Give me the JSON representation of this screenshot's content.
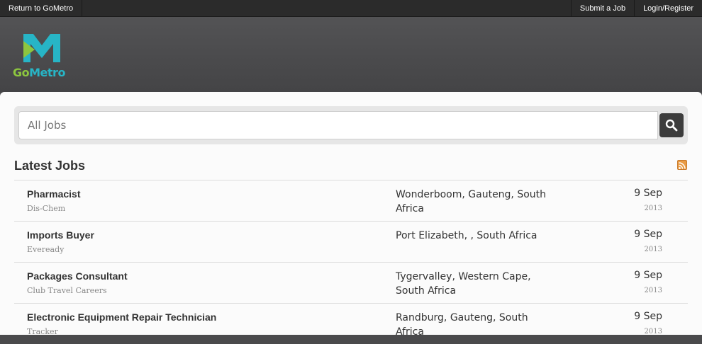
{
  "topbar": {
    "return_link": "Return to GoMetro",
    "submit_job": "Submit a Job",
    "login_register": "Login/Register"
  },
  "logo": {
    "text_go": "Go",
    "text_metro": "Metro",
    "colors": {
      "green": "#8dc63f",
      "teal": "#27b5c6"
    }
  },
  "search": {
    "placeholder": "All Jobs",
    "button_icon": "search-icon"
  },
  "latest_jobs": {
    "title": "Latest Jobs",
    "feed_icon": "rss-icon",
    "jobs": [
      {
        "title": "Pharmacist",
        "company": "Dis-Chem",
        "location": "Wonderboom, Gauteng, South Africa",
        "date": "9 Sep",
        "year": "2013"
      },
      {
        "title": "Imports Buyer",
        "company": "Eveready",
        "location": "Port Elizabeth, , South Africa",
        "date": "9 Sep",
        "year": "2013"
      },
      {
        "title": "Packages Consultant",
        "company": "Club Travel Careers",
        "location": "Tygervalley, Western Cape, South Africa",
        "date": "9 Sep",
        "year": "2013"
      },
      {
        "title": "Electronic Equipment Repair Technician",
        "company": "Tracker",
        "location": "Randburg, Gauteng, South Africa",
        "date": "9 Sep",
        "year": "2013"
      }
    ]
  }
}
